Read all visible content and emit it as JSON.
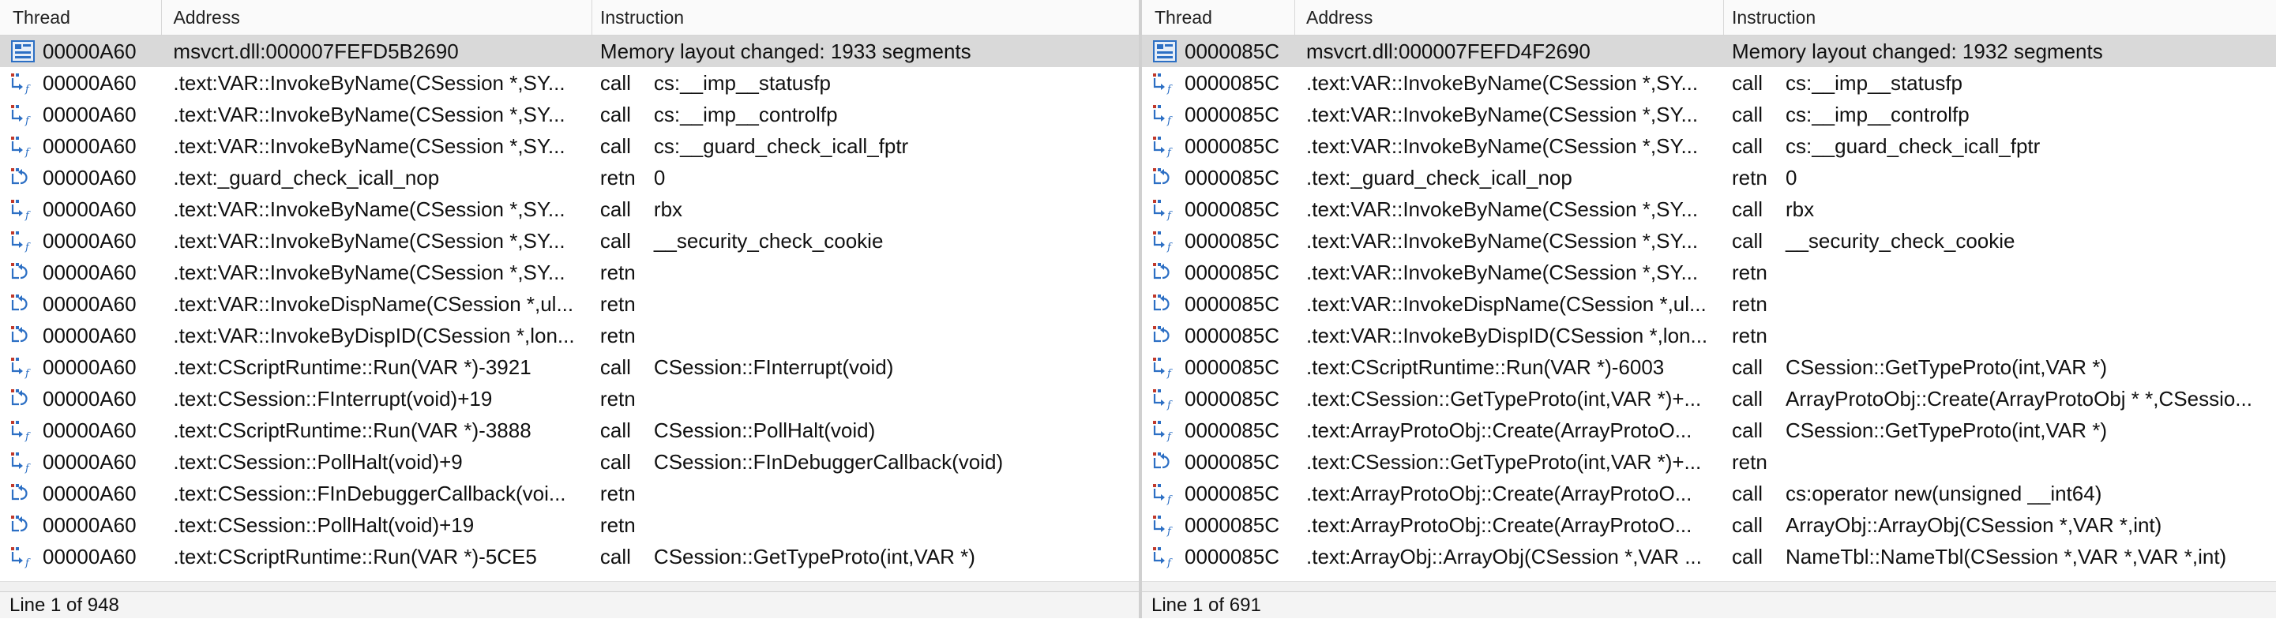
{
  "left": {
    "columns": {
      "thread": "Thread",
      "address": "Address",
      "instruction": "Instruction"
    },
    "status": "Line 1 of 948",
    "rows": [
      {
        "icon": "memory-layout-icon",
        "thread": "00000A60",
        "address": "msvcrt.dll:000007FEFD5B2690",
        "op": "",
        "operand": "Memory layout changed: 1933 segments",
        "selected": true
      },
      {
        "icon": "call-icon",
        "thread": "00000A60",
        "address": ".text:VAR::InvokeByName(CSession *,SY...",
        "op": "call",
        "operand": "cs:__imp__statusfp"
      },
      {
        "icon": "call-icon",
        "thread": "00000A60",
        "address": ".text:VAR::InvokeByName(CSession *,SY...",
        "op": "call",
        "operand": "cs:__imp__controlfp"
      },
      {
        "icon": "call-icon",
        "thread": "00000A60",
        "address": ".text:VAR::InvokeByName(CSession *,SY...",
        "op": "call",
        "operand": "cs:__guard_check_icall_fptr"
      },
      {
        "icon": "return-icon",
        "thread": "00000A60",
        "address": ".text:_guard_check_icall_nop",
        "op": "retn",
        "operand": "0"
      },
      {
        "icon": "call-icon",
        "thread": "00000A60",
        "address": ".text:VAR::InvokeByName(CSession *,SY...",
        "op": "call",
        "operand": "rbx"
      },
      {
        "icon": "call-icon",
        "thread": "00000A60",
        "address": ".text:VAR::InvokeByName(CSession *,SY...",
        "op": "call",
        "operand": "__security_check_cookie"
      },
      {
        "icon": "return-icon",
        "thread": "00000A60",
        "address": ".text:VAR::InvokeByName(CSession *,SY...",
        "op": "retn",
        "operand": ""
      },
      {
        "icon": "return-icon",
        "thread": "00000A60",
        "address": ".text:VAR::InvokeDispName(CSession *,ul...",
        "op": "retn",
        "operand": ""
      },
      {
        "icon": "return-icon",
        "thread": "00000A60",
        "address": ".text:VAR::InvokeByDispID(CSession *,lon...",
        "op": "retn",
        "operand": ""
      },
      {
        "icon": "call-icon",
        "thread": "00000A60",
        "address": ".text:CScriptRuntime::Run(VAR *)-3921",
        "op": "call",
        "operand": "CSession::FInterrupt(void)"
      },
      {
        "icon": "return-icon",
        "thread": "00000A60",
        "address": ".text:CSession::FInterrupt(void)+19",
        "op": "retn",
        "operand": ""
      },
      {
        "icon": "call-icon",
        "thread": "00000A60",
        "address": ".text:CScriptRuntime::Run(VAR *)-3888",
        "op": "call",
        "operand": "CSession::PollHalt(void)"
      },
      {
        "icon": "call-icon",
        "thread": "00000A60",
        "address": ".text:CSession::PollHalt(void)+9",
        "op": "call",
        "operand": "CSession::FInDebuggerCallback(void)"
      },
      {
        "icon": "return-icon",
        "thread": "00000A60",
        "address": ".text:CSession::FInDebuggerCallback(voi...",
        "op": "retn",
        "operand": ""
      },
      {
        "icon": "return-icon",
        "thread": "00000A60",
        "address": ".text:CSession::PollHalt(void)+19",
        "op": "retn",
        "operand": ""
      },
      {
        "icon": "call-icon",
        "thread": "00000A60",
        "address": ".text:CScriptRuntime::Run(VAR *)-5CE5",
        "op": "call",
        "operand": "CSession::GetTypeProto(int,VAR *)"
      }
    ]
  },
  "right": {
    "columns": {
      "thread": "Thread",
      "address": "Address",
      "instruction": "Instruction"
    },
    "status": "Line 1 of 691",
    "rows": [
      {
        "icon": "memory-layout-icon",
        "thread": "0000085C",
        "address": "msvcrt.dll:000007FEFD4F2690",
        "op": "",
        "operand": "Memory layout changed: 1932 segments",
        "selected": true
      },
      {
        "icon": "call-icon",
        "thread": "0000085C",
        "address": ".text:VAR::InvokeByName(CSession *,SY...",
        "op": "call",
        "operand": "cs:__imp__statusfp"
      },
      {
        "icon": "call-icon",
        "thread": "0000085C",
        "address": ".text:VAR::InvokeByName(CSession *,SY...",
        "op": "call",
        "operand": "cs:__imp__controlfp"
      },
      {
        "icon": "call-icon",
        "thread": "0000085C",
        "address": ".text:VAR::InvokeByName(CSession *,SY...",
        "op": "call",
        "operand": "cs:__guard_check_icall_fptr"
      },
      {
        "icon": "return-icon",
        "thread": "0000085C",
        "address": ".text:_guard_check_icall_nop",
        "op": "retn",
        "operand": "0"
      },
      {
        "icon": "call-icon",
        "thread": "0000085C",
        "address": ".text:VAR::InvokeByName(CSession *,SY...",
        "op": "call",
        "operand": "rbx"
      },
      {
        "icon": "call-icon",
        "thread": "0000085C",
        "address": ".text:VAR::InvokeByName(CSession *,SY...",
        "op": "call",
        "operand": "__security_check_cookie"
      },
      {
        "icon": "return-icon",
        "thread": "0000085C",
        "address": ".text:VAR::InvokeByName(CSession *,SY...",
        "op": "retn",
        "operand": ""
      },
      {
        "icon": "return-icon",
        "thread": "0000085C",
        "address": ".text:VAR::InvokeDispName(CSession *,ul...",
        "op": "retn",
        "operand": ""
      },
      {
        "icon": "return-icon",
        "thread": "0000085C",
        "address": ".text:VAR::InvokeByDispID(CSession *,lon...",
        "op": "retn",
        "operand": ""
      },
      {
        "icon": "call-icon",
        "thread": "0000085C",
        "address": ".text:CScriptRuntime::Run(VAR *)-6003",
        "op": "call",
        "operand": "CSession::GetTypeProto(int,VAR *)"
      },
      {
        "icon": "call-icon",
        "thread": "0000085C",
        "address": ".text:CSession::GetTypeProto(int,VAR *)+...",
        "op": "call",
        "operand": "ArrayProtoObj::Create(ArrayProtoObj * *,CSessio..."
      },
      {
        "icon": "call-icon",
        "thread": "0000085C",
        "address": ".text:ArrayProtoObj::Create(ArrayProtoO...",
        "op": "call",
        "operand": "CSession::GetTypeProto(int,VAR *)"
      },
      {
        "icon": "return-icon",
        "thread": "0000085C",
        "address": ".text:CSession::GetTypeProto(int,VAR *)+...",
        "op": "retn",
        "operand": ""
      },
      {
        "icon": "call-icon",
        "thread": "0000085C",
        "address": ".text:ArrayProtoObj::Create(ArrayProtoO...",
        "op": "call",
        "operand": "cs:operator new(unsigned __int64)"
      },
      {
        "icon": "call-icon",
        "thread": "0000085C",
        "address": ".text:ArrayProtoObj::Create(ArrayProtoO...",
        "op": "call",
        "operand": "ArrayObj::ArrayObj(CSession *,VAR *,int)"
      },
      {
        "icon": "call-icon",
        "thread": "0000085C",
        "address": ".text:ArrayObj::ArrayObj(CSession *,VAR ...",
        "op": "call",
        "operand": "NameTbl::NameTbl(CSession *,VAR *,VAR *,int)"
      }
    ]
  }
}
